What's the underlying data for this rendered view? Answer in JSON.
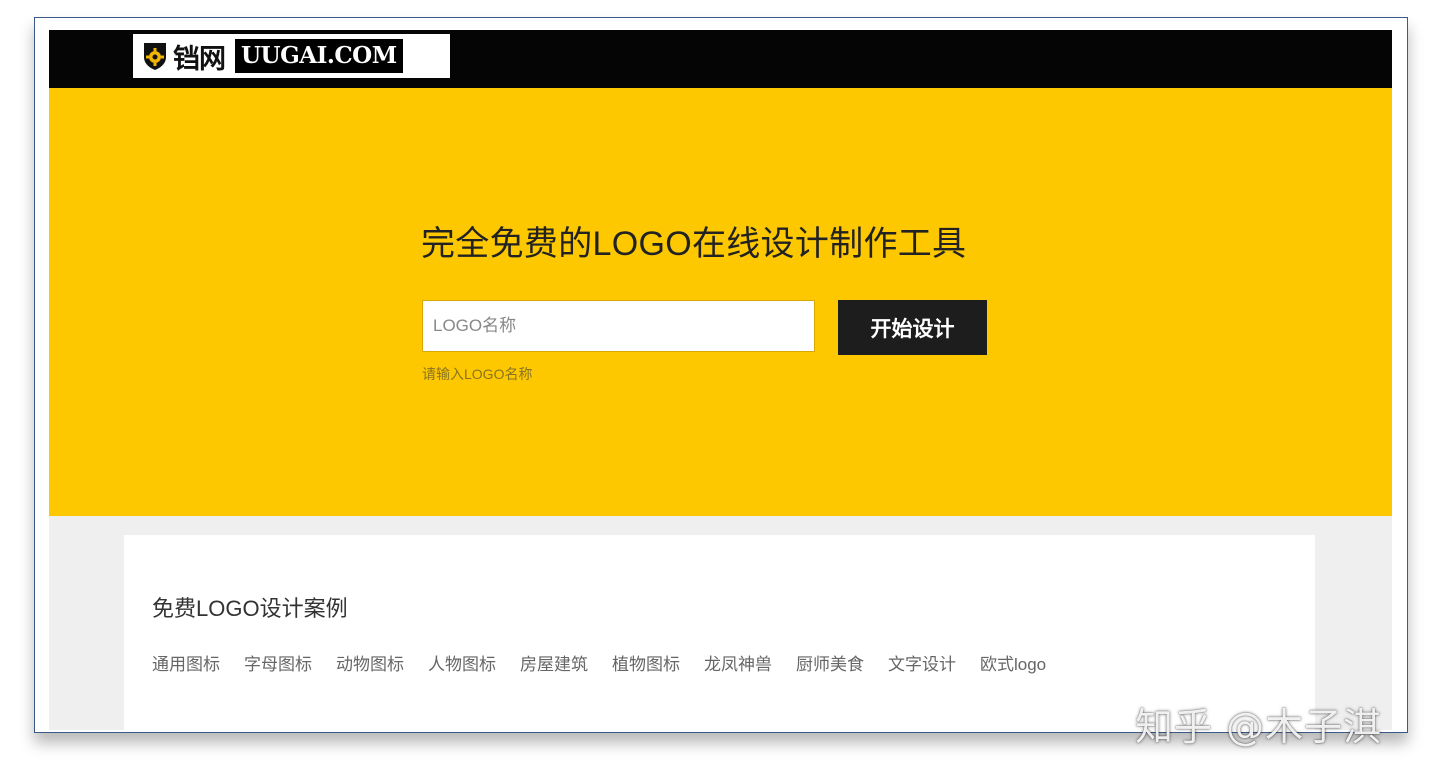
{
  "header": {
    "logo_cn": "铛网",
    "logo_en": "UUGAI.COM"
  },
  "hero": {
    "title": "完全免费的LOGO在线设计制作工具",
    "input_placeholder": "LOGO名称",
    "input_value": "",
    "start_button": "开始设计",
    "hint": "请输入LOGO名称"
  },
  "cases": {
    "title": "免费LOGO设计案例",
    "categories": [
      "通用图标",
      "字母图标",
      "动物图标",
      "人物图标",
      "房屋建筑",
      "植物图标",
      "龙凤神兽",
      "厨师美食",
      "文字设计",
      "欧式logo"
    ]
  },
  "watermark": "知乎 @木子淇",
  "colors": {
    "hero_bg": "#fdc800",
    "topbar_bg": "#050505",
    "button_bg": "#1d1d1d"
  },
  "icons": {
    "logo_mark": "shield-gear-icon"
  }
}
